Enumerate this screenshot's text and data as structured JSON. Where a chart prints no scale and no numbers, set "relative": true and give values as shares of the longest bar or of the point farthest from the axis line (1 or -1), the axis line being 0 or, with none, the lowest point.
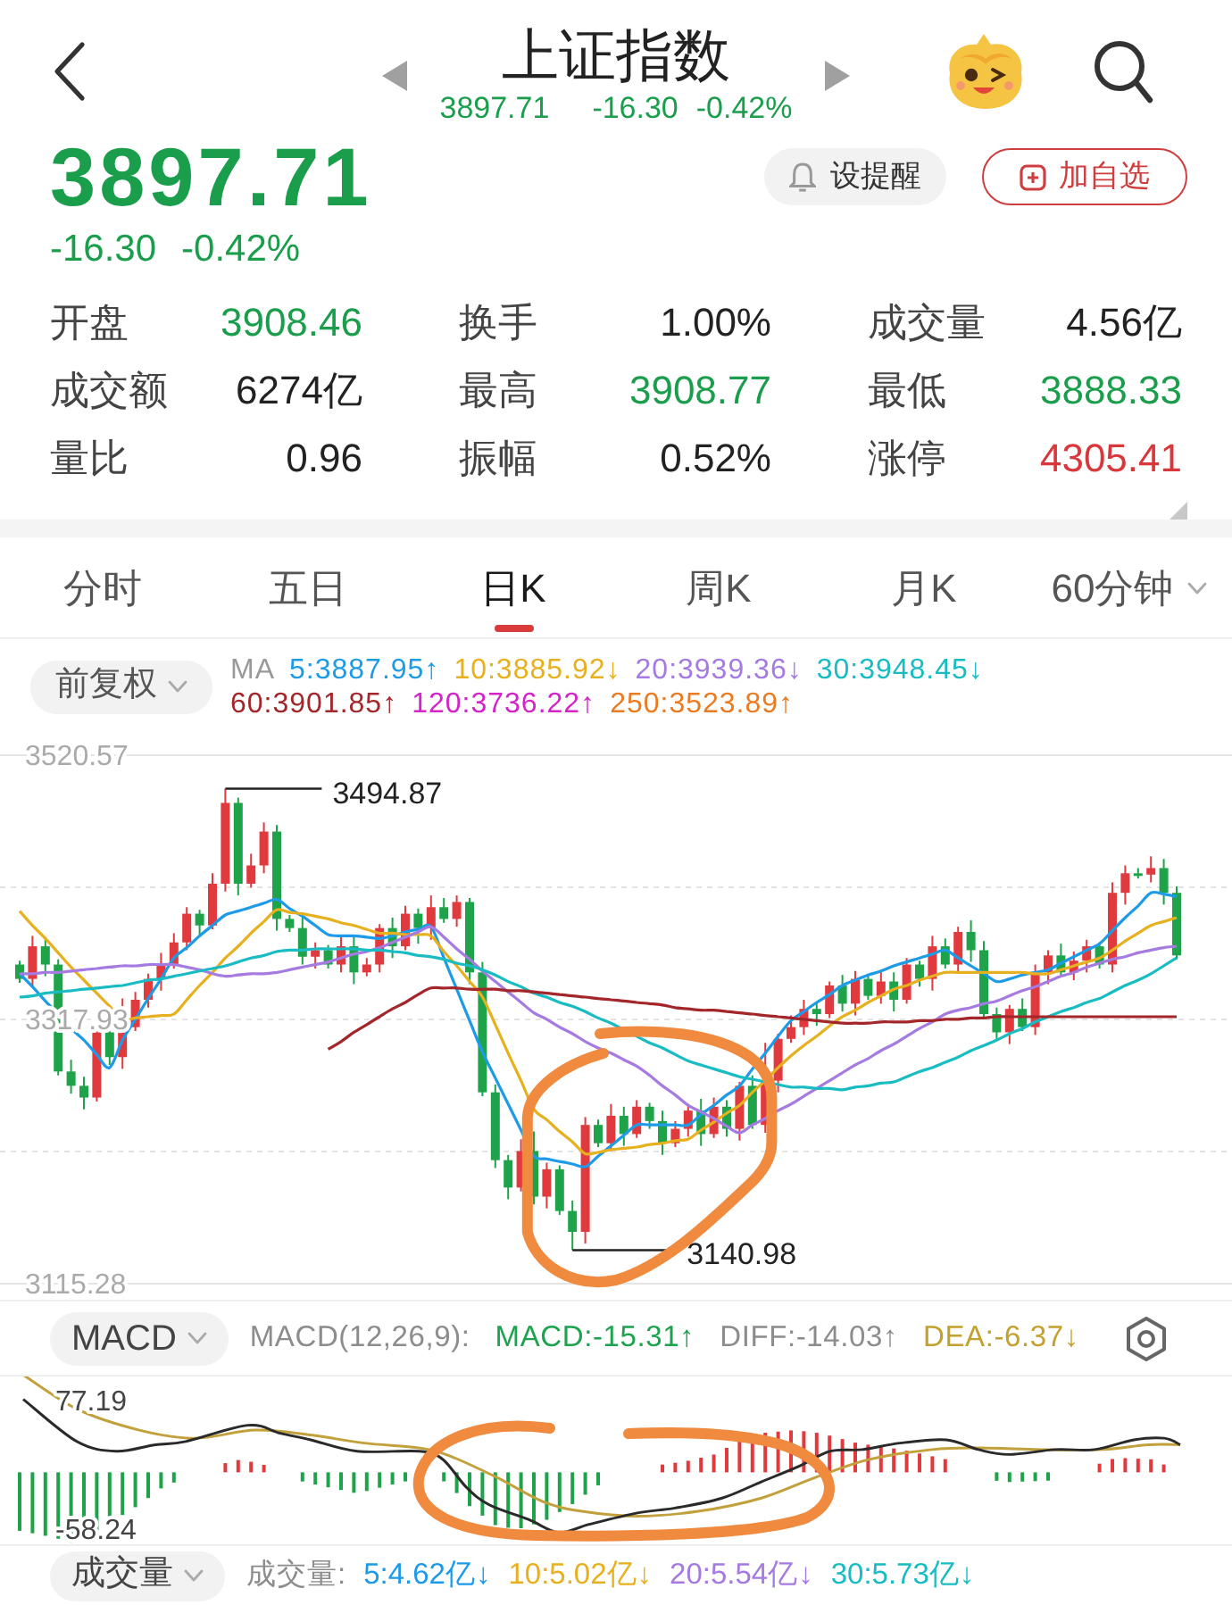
{
  "header": {
    "title": "上证指数",
    "price": "3897.71",
    "change": "-16.30",
    "change_pct": "-0.42%",
    "color": "#1a9e4c"
  },
  "quote": {
    "price": "3897.71",
    "change": "-16.30",
    "change_pct": "-0.42%",
    "color": "#1a9e4c",
    "buttons": [
      {
        "label": "设提醒",
        "kind": "alert"
      },
      {
        "label": "加自选",
        "kind": "watchlist"
      }
    ]
  },
  "stats": [
    {
      "label": "开盘",
      "value": "3908.46",
      "color": "#1a9e4c"
    },
    {
      "label": "换手",
      "value": "1.00%",
      "color": "#222222"
    },
    {
      "label": "成交量",
      "value": "4.56亿",
      "color": "#222222"
    },
    {
      "label": "成交额",
      "value": "6274亿",
      "color": "#222222"
    },
    {
      "label": "最高",
      "value": "3908.77",
      "color": "#1a9e4c"
    },
    {
      "label": "最低",
      "value": "3888.33",
      "color": "#1a9e4c"
    },
    {
      "label": "量比",
      "value": "0.96",
      "color": "#222222"
    },
    {
      "label": "振幅",
      "value": "0.52%",
      "color": "#222222"
    },
    {
      "label": "涨停",
      "value": "4305.41",
      "color": "#d8383c"
    }
  ],
  "tabs": [
    {
      "label": "分时",
      "selected": false,
      "dropdown": false
    },
    {
      "label": "五日",
      "selected": false,
      "dropdown": false
    },
    {
      "label": "日K",
      "selected": true,
      "dropdown": false
    },
    {
      "label": "周K",
      "selected": false,
      "dropdown": false
    },
    {
      "label": "月K",
      "selected": false,
      "dropdown": false
    },
    {
      "label": "60分钟",
      "selected": false,
      "dropdown": true
    }
  ],
  "price_chart": {
    "adjust": "前复权",
    "ma_title": "MA",
    "ma_items": [
      {
        "text": "5:3887.95↑",
        "color": "#1e9be8"
      },
      {
        "text": "10:3885.92↓",
        "color": "#e6b01e"
      },
      {
        "text": "20:3939.36↓",
        "color": "#a57be2"
      },
      {
        "text": "30:3948.45↓",
        "color": "#19bcc2"
      },
      {
        "text": "60:3901.85↑",
        "color": "#a3262b"
      },
      {
        "text": "120:3736.22↑",
        "color": "#d324c9"
      },
      {
        "text": "250:3523.89↑",
        "color": "#ea7b21"
      }
    ],
    "high_label": "3494.87",
    "low_label": "3140.98",
    "chart_data": {
      "type": "candlestick",
      "ylim": [
        3115.28,
        3520.57
      ],
      "yticks": [
        3520.57,
        3317.93,
        3115.28
      ],
      "ohlc": [
        [
          3360,
          3363,
          3346,
          3349
        ],
        [
          3349,
          3382,
          3343,
          3374
        ],
        [
          3374,
          3380,
          3351,
          3360
        ],
        [
          3360,
          3364,
          3275,
          3278
        ],
        [
          3278,
          3287,
          3261,
          3267
        ],
        [
          3267,
          3274,
          3249,
          3258
        ],
        [
          3258,
          3313,
          3255,
          3308
        ],
        [
          3308,
          3311,
          3283,
          3289
        ],
        [
          3289,
          3334,
          3280,
          3312
        ],
        [
          3312,
          3339,
          3309,
          3333
        ],
        [
          3333,
          3353,
          3327,
          3349
        ],
        [
          3349,
          3369,
          3340,
          3360
        ],
        [
          3360,
          3384,
          3357,
          3377
        ],
        [
          3377,
          3404,
          3371,
          3399
        ],
        [
          3399,
          3402,
          3381,
          3390
        ],
        [
          3390,
          3430,
          3387,
          3422
        ],
        [
          3422,
          3494.87,
          3416,
          3484
        ],
        [
          3484,
          3488,
          3413,
          3422
        ],
        [
          3422,
          3445,
          3419,
          3436
        ],
        [
          3436,
          3469,
          3430,
          3462
        ],
        [
          3462,
          3467,
          3386,
          3395
        ],
        [
          3395,
          3398,
          3385,
          3388
        ],
        [
          3388,
          3396,
          3360,
          3366
        ],
        [
          3366,
          3377,
          3357,
          3371
        ],
        [
          3371,
          3375,
          3357,
          3360
        ],
        [
          3360,
          3383,
          3354,
          3374
        ],
        [
          3374,
          3381,
          3345,
          3354
        ],
        [
          3354,
          3365,
          3351,
          3360
        ],
        [
          3360,
          3391,
          3354,
          3388
        ],
        [
          3388,
          3396,
          3365,
          3374
        ],
        [
          3374,
          3405,
          3371,
          3399
        ],
        [
          3399,
          3403,
          3376,
          3388
        ],
        [
          3388,
          3413,
          3379,
          3404
        ],
        [
          3404,
          3411,
          3392,
          3395
        ],
        [
          3395,
          3413,
          3389,
          3408
        ],
        [
          3408,
          3411,
          3345,
          3354
        ],
        [
          3354,
          3362,
          3259,
          3262
        ],
        [
          3262,
          3268,
          3204,
          3210
        ],
        [
          3210,
          3214,
          3180,
          3189
        ],
        [
          3189,
          3226,
          3186,
          3217
        ],
        [
          3217,
          3232,
          3176,
          3182
        ],
        [
          3182,
          3208,
          3173,
          3203
        ],
        [
          3203,
          3206,
          3168,
          3171
        ],
        [
          3171,
          3179,
          3140.98,
          3155
        ],
        [
          3155,
          3243,
          3146,
          3237
        ],
        [
          3237,
          3241,
          3220,
          3223
        ],
        [
          3223,
          3253,
          3217,
          3244
        ],
        [
          3244,
          3251,
          3221,
          3230
        ],
        [
          3230,
          3256,
          3227,
          3251
        ],
        [
          3251,
          3254,
          3234,
          3240
        ],
        [
          3240,
          3248,
          3214,
          3223
        ],
        [
          3223,
          3240,
          3220,
          3234
        ],
        [
          3234,
          3252,
          3228,
          3248
        ],
        [
          3248,
          3257,
          3221,
          3230
        ],
        [
          3230,
          3258,
          3227,
          3251
        ],
        [
          3251,
          3256,
          3228,
          3234
        ],
        [
          3234,
          3270,
          3225,
          3267
        ],
        [
          3267,
          3275,
          3234,
          3237
        ],
        [
          3237,
          3300,
          3231,
          3271
        ],
        [
          3271,
          3307,
          3262,
          3303
        ],
        [
          3303,
          3321,
          3300,
          3312
        ],
        [
          3312,
          3333,
          3306,
          3326
        ],
        [
          3326,
          3331,
          3313,
          3322
        ],
        [
          3322,
          3347,
          3319,
          3344
        ],
        [
          3344,
          3352,
          3324,
          3330
        ],
        [
          3330,
          3355,
          3321,
          3349
        ],
        [
          3349,
          3353,
          3333,
          3336
        ],
        [
          3336,
          3356,
          3330,
          3347
        ],
        [
          3347,
          3354,
          3324,
          3333
        ],
        [
          3333,
          3365,
          3330,
          3360
        ],
        [
          3360,
          3363,
          3343,
          3349
        ],
        [
          3349,
          3382,
          3340,
          3374
        ],
        [
          3374,
          3380,
          3357,
          3360
        ],
        [
          3360,
          3389,
          3354,
          3385
        ],
        [
          3385,
          3394,
          3362,
          3371
        ],
        [
          3371,
          3378,
          3319,
          3322
        ],
        [
          3322,
          3327,
          3302,
          3308
        ],
        [
          3308,
          3329,
          3299,
          3326
        ],
        [
          3326,
          3334,
          3309,
          3312
        ],
        [
          3312,
          3360,
          3306,
          3354
        ],
        [
          3354,
          3371,
          3345,
          3367
        ],
        [
          3367,
          3376,
          3351,
          3354
        ],
        [
          3354,
          3370,
          3348,
          3363
        ],
        [
          3363,
          3379,
          3354,
          3374
        ],
        [
          3374,
          3377,
          3357,
          3360
        ],
        [
          3360,
          3423,
          3354,
          3415
        ],
        [
          3415,
          3436,
          3406,
          3430
        ],
        [
          3430,
          3434,
          3426,
          3429
        ],
        [
          3429,
          3443,
          3423,
          3434
        ],
        [
          3434,
          3441,
          3406,
          3415
        ],
        [
          3415,
          3420,
          3364,
          3367
        ]
      ]
    },
    "ma_overlay": {
      "chart_data": {
        "type": "line",
        "relative": true,
        "ylim": [
          3115.28,
          3520.57
        ],
        "series": [
          {
            "color": "#1e9be8",
            "values": [
              3353,
              3343,
              3332,
              3322,
              3311,
              3302,
              3291,
              3281,
              3302,
              3318,
              3334,
              3349,
              3365,
              3373,
              3382,
              3390,
              3398,
              3401,
              3404,
              3407,
              3410,
              3403,
              3397,
              3390,
              3383,
              3382,
              3382,
              3381,
              3380,
              3382,
              3385,
              3387,
              3389,
              3365,
              3341,
              3317,
              3293,
              3273,
              3253,
              3233,
              3213,
              3211,
              3209,
              3207,
              3205,
              3213,
              3221,
              3229,
              3237,
              3237,
              3237,
              3237,
              3237,
              3245,
              3252,
              3260,
              3267,
              3280,
              3292,
              3305,
              3317,
              3324,
              3331,
              3337,
              3344,
              3348,
              3352,
              3355,
              3359,
              3362,
              3365,
              3368,
              3371,
              3365,
              3359,
              3353,
              3347,
              3349,
              3352,
              3354,
              3356,
              3361,
              3366,
              3371,
              3376,
              3386,
              3396,
              3405,
              3415,
              3414,
              3412
            ]
          },
          {
            "color": "#e6b01e",
            "values": [
              3401,
              3390,
              3380,
              3369,
              3358,
              3348,
              3338,
              3328,
              3318,
              3319,
              3320,
              3321,
              3322,
              3333,
              3344,
              3354,
              3365,
              3374,
              3384,
              3393,
              3402,
              3400,
              3399,
              3397,
              3395,
              3392,
              3390,
              3387,
              3384,
              3384,
              3383,
              3383,
              3382,
              3370,
              3359,
              3347,
              3335,
              3314,
              3292,
              3271,
              3249,
              3241,
              3232,
              3224,
              3215,
              3216,
              3218,
              3219,
              3220,
              3222,
              3223,
              3225,
              3226,
              3233,
              3239,
              3246,
              3252,
              3262,
              3271,
              3281,
              3290,
              3298,
              3305,
              3313,
              3320,
              3325,
              3331,
              3336,
              3341,
              3344,
              3348,
              3351,
              3354,
              3354,
              3354,
              3354,
              3354,
              3354,
              3354,
              3353,
              3353,
              3356,
              3359,
              3362,
              3365,
              3371,
              3378,
              3384,
              3390,
              3393,
              3396
            ]
          },
          {
            "color": "#a57be2",
            "values": [
              3353,
              3353,
              3354,
              3354,
              3355,
              3356,
              3357,
              3358,
              3359,
              3359,
              3360,
              3360,
              3360,
              3358,
              3356,
              3353,
              3351,
              3352,
              3353,
              3353,
              3354,
              3356,
              3358,
              3360,
              3362,
              3365,
              3368,
              3370,
              3373,
              3377,
              3381,
              3385,
              3389,
              3381,
              3372,
              3364,
              3355,
              3347,
              3339,
              3331,
              3323,
              3318,
              3312,
              3307,
              3301,
              3296,
              3292,
              3287,
              3282,
              3275,
              3267,
              3260,
              3252,
              3247,
              3242,
              3236,
              3231,
              3237,
              3242,
              3248,
              3253,
              3259,
              3265,
              3271,
              3277,
              3283,
              3288,
              3294,
              3299,
              3305,
              3311,
              3316,
              3322,
              3325,
              3327,
              3330,
              3332,
              3336,
              3340,
              3343,
              3347,
              3351,
              3354,
              3358,
              3361,
              3364,
              3366,
              3369,
              3371,
              3373,
              3374
            ]
          },
          {
            "color": "#19bcc2",
            "values": [
              3335,
              3336,
              3338,
              3339,
              3340,
              3341,
              3342,
              3343,
              3344,
              3346,
              3348,
              3349,
              3351,
              3353,
              3355,
              3357,
              3359,
              3362,
              3365,
              3367,
              3370,
              3371,
              3371,
              3372,
              3372,
              3372,
              3372,
              3371,
              3371,
              3370,
              3369,
              3367,
              3366,
              3364,
              3361,
              3359,
              3356,
              3352,
              3347,
              3343,
              3338,
              3335,
              3331,
              3328,
              3324,
              3319,
              3315,
              3310,
              3305,
              3300,
              3296,
              3291,
              3286,
              3283,
              3280,
              3277,
              3274,
              3272,
              3270,
              3268,
              3266,
              3266,
              3265,
              3265,
              3264,
              3266,
              3267,
              3269,
              3270,
              3274,
              3278,
              3281,
              3285,
              3289,
              3294,
              3298,
              3302,
              3307,
              3311,
              3316,
              3320,
              3324,
              3327,
              3331,
              3334,
              3339,
              3344,
              3348,
              3353,
              3359,
              3365
            ]
          },
          {
            "color": "#a3262b",
            "values": [
              null,
              null,
              null,
              null,
              null,
              null,
              null,
              null,
              null,
              null,
              null,
              null,
              null,
              null,
              null,
              null,
              null,
              null,
              null,
              null,
              null,
              null,
              null,
              null,
              3295,
              3301,
              3308,
              3314,
              3320,
              3326,
              3331,
              3337,
              3342,
              3342,
              3342,
              3341,
              3341,
              3341,
              3340,
              3340,
              3339,
              3338,
              3337,
              3336,
              3335,
              3334,
              3333,
              3332,
              3331,
              3330,
              3329,
              3327,
              3326,
              3325,
              3325,
              3324,
              3323,
              3322,
              3321,
              3320,
              3319,
              3318,
              3317,
              3316,
              3315,
              3315,
              3315,
              3316,
              3316,
              3316,
              3317,
              3317,
              3318,
              3318,
              3319,
              3319,
              3320,
              3320,
              3320,
              3320,
              3320,
              3320,
              3320,
              3320,
              3320,
              3320,
              3320,
              3320,
              3320,
              3320,
              3320
            ]
          }
        ]
      }
    }
  },
  "macd_panel": {
    "indicator": "MACD",
    "params": "MACD(12,26,9):",
    "values": [
      {
        "text": "MACD:-15.31↑",
        "color": "#1da24e"
      },
      {
        "text": "DIFF:-14.03↑",
        "color": "#8c8c8c"
      },
      {
        "text": "DEA:-6.37↓",
        "color": "#c4a12e"
      }
    ],
    "y_labels": [
      "77.19",
      "-58.24"
    ]
  },
  "volume_panel": {
    "indicator": "成交量",
    "title": "成交量:",
    "values": [
      {
        "text": "5:4.62亿↓",
        "color": "#1e9be8"
      },
      {
        "text": "10:5.02亿↓",
        "color": "#e6b01e"
      },
      {
        "text": "20:5.54亿↓",
        "color": "#a57be2"
      },
      {
        "text": "30:5.73亿↓",
        "color": "#19bcc2"
      }
    ]
  }
}
